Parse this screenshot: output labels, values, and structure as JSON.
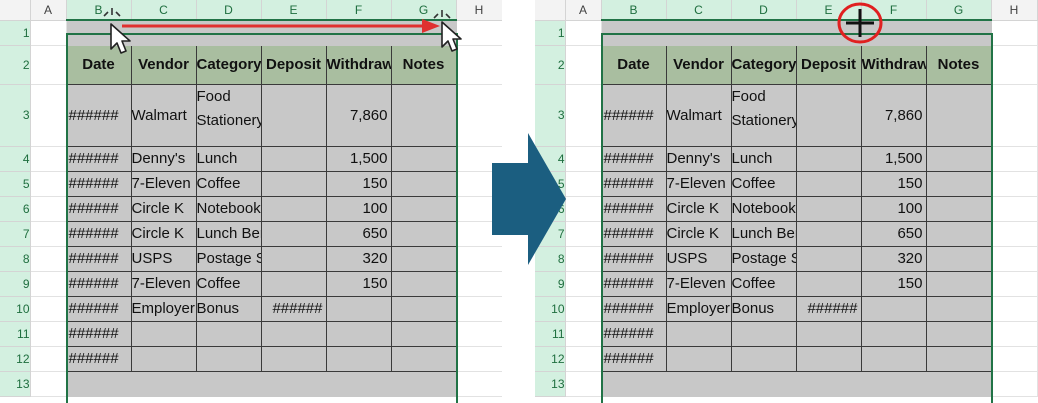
{
  "columns": [
    "",
    "A",
    "B",
    "C",
    "D",
    "E",
    "F",
    "G",
    "H"
  ],
  "row_numbers": [
    "1",
    "2",
    "3",
    "4",
    "5",
    "6",
    "7",
    "8",
    "9",
    "10",
    "11",
    "12",
    "13"
  ],
  "header_row": [
    "Date",
    "Vendor",
    "Category",
    "Deposit",
    "Withdrawal",
    "Notes"
  ],
  "rows": [
    [
      "######",
      "Walmart",
      "Food Stationery",
      "",
      "7,860",
      ""
    ],
    [
      "######",
      "Denny's",
      "Lunch",
      "",
      "1,500",
      ""
    ],
    [
      "######",
      "7-Eleven",
      "Coffee",
      "",
      "150",
      ""
    ],
    [
      "######",
      "Circle K",
      "Notebook for Meeting",
      "",
      "100",
      ""
    ],
    [
      "######",
      "Circle K",
      "Lunch Bento",
      "",
      "650",
      ""
    ],
    [
      "######",
      "USPS",
      "Postage Stamps",
      "",
      "320",
      ""
    ],
    [
      "######",
      "7-Eleven",
      "Coffee",
      "",
      "150",
      ""
    ],
    [
      "######",
      "Employer",
      "Bonus",
      "######",
      "",
      ""
    ],
    [
      "######",
      "",
      "",
      "",
      "",
      ""
    ],
    [
      "######",
      "",
      "",
      "",
      "",
      ""
    ]
  ],
  "colors": {
    "selection_green": "#217346",
    "header_fill": "#a9bea0",
    "data_fill": "#c8c8c8",
    "transition_arrow": "#1b5e80",
    "drag_arrow": "#e03030",
    "highlight_circle": "#e02020"
  },
  "icons": {
    "transition": "right-block-arrow",
    "drag": "red-right-arrow",
    "cursor_left": "mouse-pointer",
    "cursor_right": "mouse-pointer",
    "plus": "crosshair-plus"
  }
}
